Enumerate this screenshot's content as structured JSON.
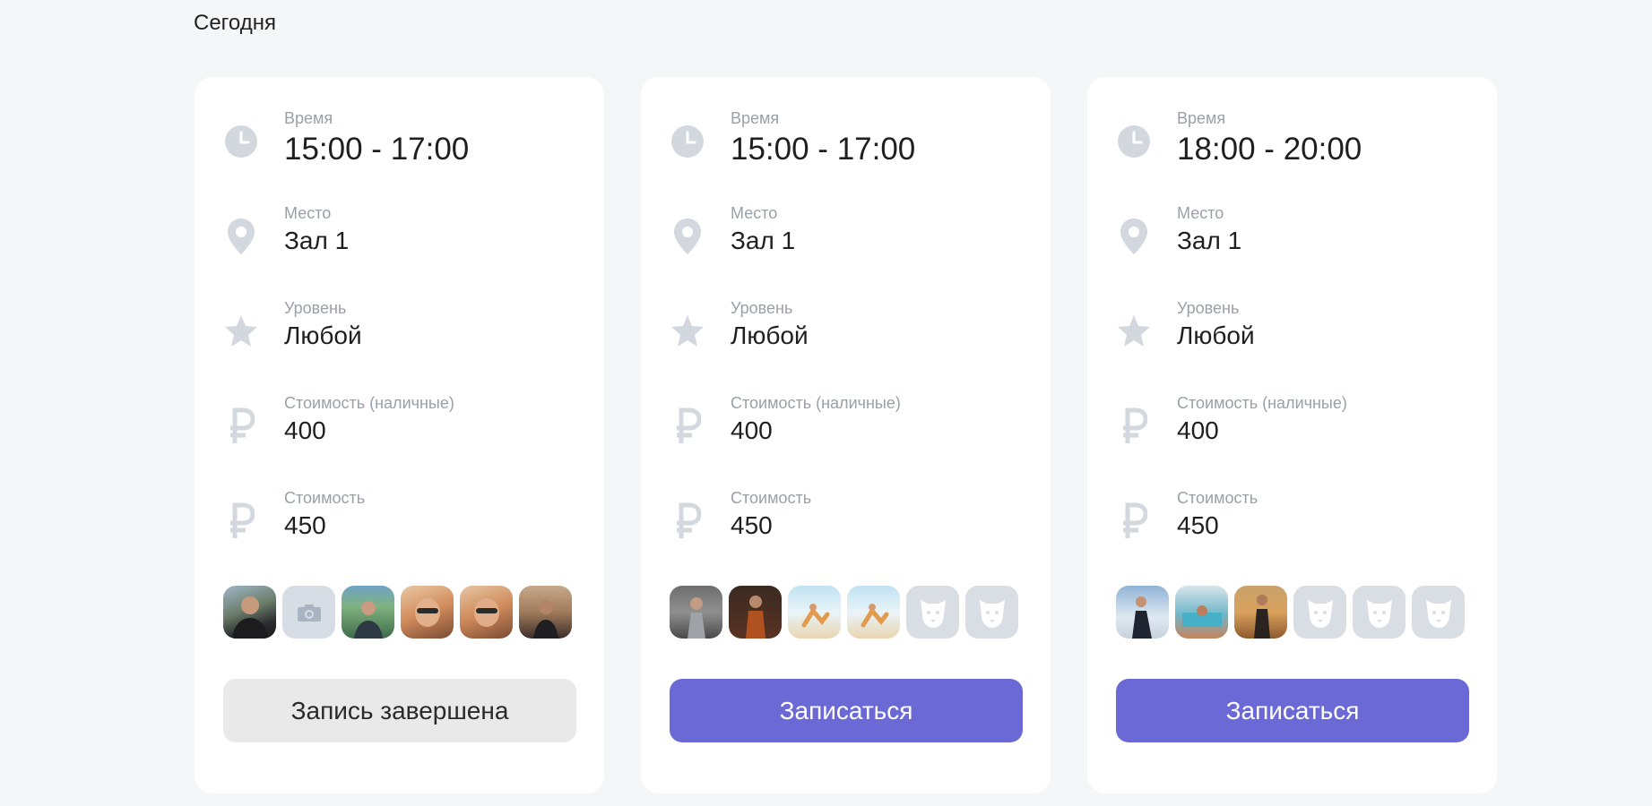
{
  "section": {
    "title": "Сегодня"
  },
  "colors": {
    "background": "#f5f6f8",
    "card": "#ffffff",
    "icon": "#d3d8df",
    "label": "#9aa0a8",
    "primary_button": "#6a69d6",
    "disabled_button": "#e9e9ea"
  },
  "labels": {
    "time": "Время",
    "place": "Место",
    "level": "Уровень",
    "cost_cash": "Стоимость (наличные)",
    "cost": "Стоимость"
  },
  "cards": [
    {
      "time": "15:00 - 17:00",
      "place": "Зал 1",
      "level": "Любой",
      "cost_cash": "400",
      "cost": "450",
      "avatars": [
        "photo-person",
        "camera-placeholder",
        "photo-person",
        "photo-person",
        "photo-person",
        "photo-person"
      ],
      "button": "Запись завершена",
      "button_state": "disabled"
    },
    {
      "time": "15:00 - 17:00",
      "place": "Зал 1",
      "level": "Любой",
      "cost_cash": "400",
      "cost": "450",
      "avatars": [
        "photo-person",
        "photo-person",
        "photo-beach",
        "photo-beach",
        "dog-placeholder",
        "dog-placeholder"
      ],
      "button": "Записаться",
      "button_state": "primary"
    },
    {
      "time": "18:00 - 20:00",
      "place": "Зал 1",
      "level": "Любой",
      "cost_cash": "400",
      "cost": "450",
      "avatars": [
        "photo-person",
        "photo-beach",
        "photo-person",
        "dog-placeholder",
        "dog-placeholder",
        "dog-placeholder"
      ],
      "button": "Записаться",
      "button_state": "primary"
    }
  ],
  "icons": {
    "time": "clock-icon",
    "place": "location-pin-icon",
    "level": "star-icon",
    "cost_cash": "ruble-icon",
    "cost": "ruble-icon"
  }
}
